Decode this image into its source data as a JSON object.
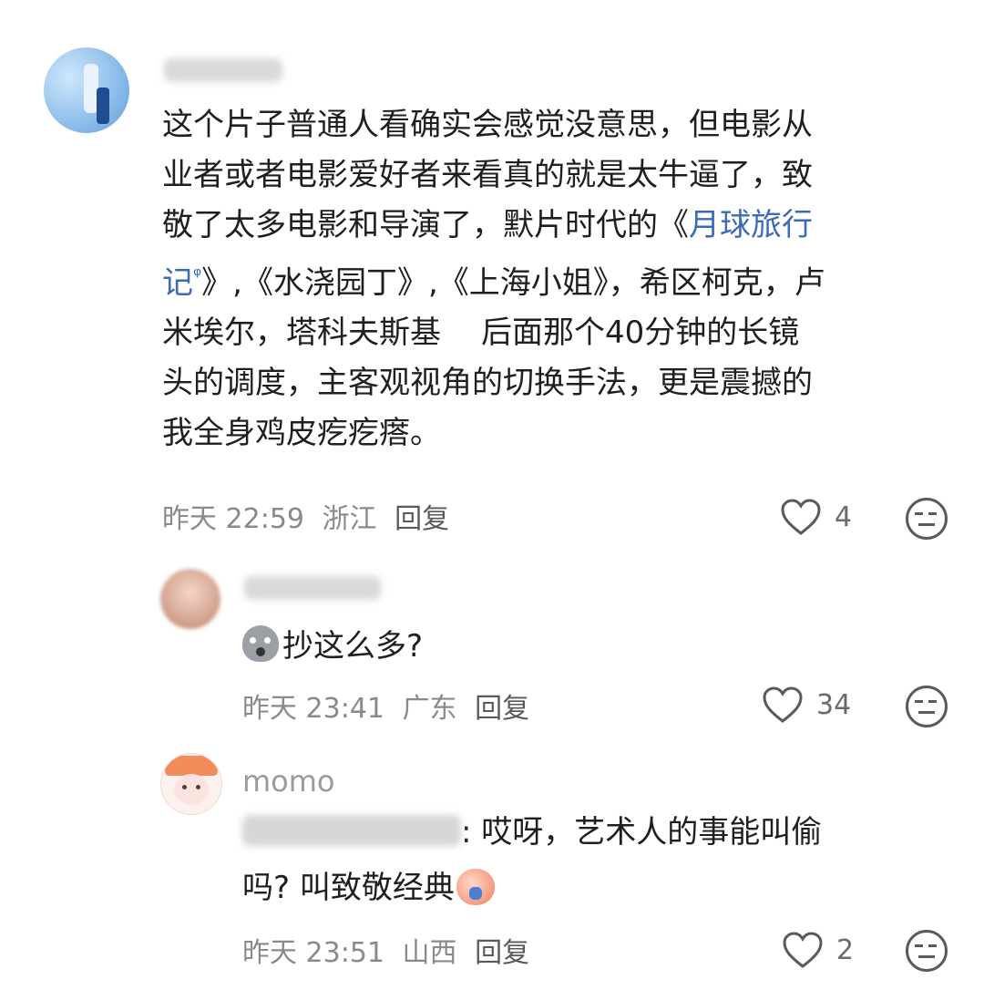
{
  "comments": [
    {
      "text_lines": [
        "这个片子普通人看确实会感觉没意思，但电影从",
        "业者或者电影爱好者来看真的就是太牛逼了，致",
        "敬了太多电影和导演了，默片时代的《",
        "》,《水浇园丁》,《上海小姐》，希区柯克，卢",
        "米埃尔，塔科夫斯基",
        "后面那个40分钟的长镜",
        "头的调度，主客观视角的切换手法，更是震撼的",
        "我全身鸡皮疙疙瘩。"
      ],
      "link_part1": "月球旅行",
      "link_part2": "记",
      "link_icon": "ᵠ",
      "meta_time": "昨天 22:59",
      "meta_location": "浙江",
      "reply_label": "回复",
      "likes": "4"
    },
    {
      "emoji_icon": "sad-bag-emoji",
      "text": "抄这么多?",
      "meta_time": "昨天 23:41",
      "meta_location": "广东",
      "reply_label": "回复",
      "likes": "34"
    },
    {
      "username": "momo",
      "text_line1": ": 哎呀，艺术人的事能叫偷",
      "text_line2": "吗? 叫致敬经典",
      "emoji_icon": "crying-peach-emoji",
      "meta_time": "昨天 23:51",
      "meta_location": "山西",
      "reply_label": "回复",
      "likes": "2"
    }
  ],
  "colors": {
    "link": "#3b6bb8",
    "meta": "#8a8a8a",
    "text": "#1f1f1f"
  }
}
